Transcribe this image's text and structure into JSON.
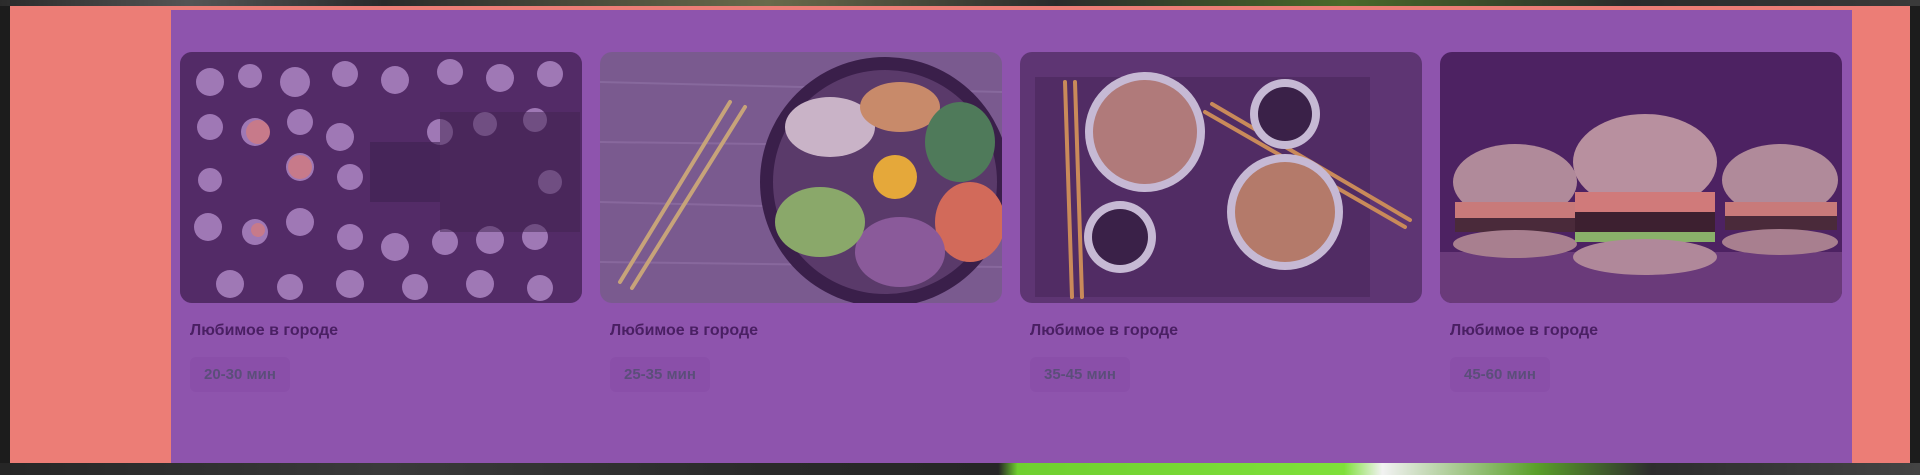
{
  "restaurants": [
    {
      "title": "Любимое в городе",
      "time": "20-30 мин",
      "image_icon": "dumplings-photo"
    },
    {
      "title": "Любимое в городе",
      "time": "25-35 мин",
      "image_icon": "bibimbap-photo"
    },
    {
      "title": "Любимое в городе",
      "time": "35-45 мин",
      "image_icon": "noodles-photo"
    },
    {
      "title": "Любимое в городе",
      "time": "45-60 мин",
      "image_icon": "burgers-photo"
    }
  ],
  "colors": {
    "side_band": "#ec7d76",
    "container": "#8e54ad",
    "title_text": "#4a1f63",
    "badge_text": "#5b4e7a"
  }
}
